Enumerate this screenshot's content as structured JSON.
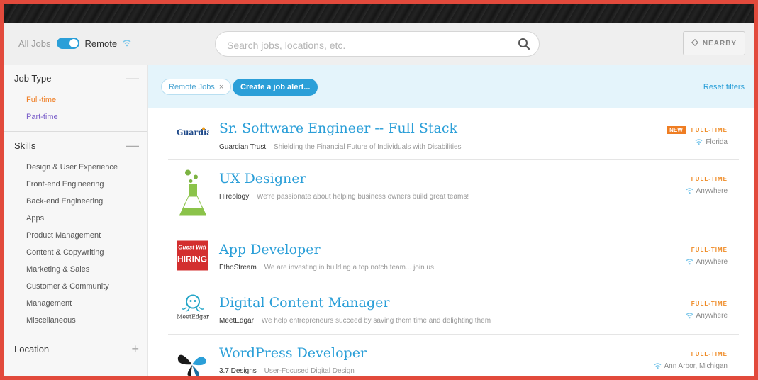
{
  "colors": {
    "accent": "#2b9fd8",
    "frame": "#e24a3c",
    "orange": "#ef7d22"
  },
  "topbar": {
    "all_jobs_label": "All Jobs",
    "remote_label": "Remote",
    "search_placeholder": "Search jobs, locations, etc.",
    "nearby_label": "NEARBY"
  },
  "sidebar": {
    "job_type": {
      "title": "Job Type",
      "items": [
        "Full-time",
        "Part-time"
      ]
    },
    "skills": {
      "title": "Skills",
      "items": [
        "Design & User Experience",
        "Front-end Engineering",
        "Back-end Engineering",
        "Apps",
        "Product Management",
        "Content & Copywriting",
        "Marketing & Sales",
        "Customer & Community",
        "Management",
        "Miscellaneous"
      ]
    },
    "location": {
      "title": "Location"
    }
  },
  "filters": {
    "chip_label": "Remote Jobs",
    "chip_close": "×",
    "alert_label": "Create a job alert...",
    "reset_label": "Reset filters"
  },
  "jobs": [
    {
      "title": "Sr. Software Engineer -- Full Stack",
      "company": "Guardian Trust",
      "tagline": "Shielding the Financial Future of Individuals with Disabilities",
      "badge": "NEW",
      "type": "FULL-TIME",
      "location": "Florida",
      "logo": "guardian-logo",
      "logo_text": "Guardian"
    },
    {
      "title": "UX Designer",
      "company": "Hireology",
      "tagline": "We're passionate about helping business owners build great teams!",
      "badge": "",
      "type": "FULL-TIME",
      "location": "Anywhere",
      "logo": "hireology-flask-logo"
    },
    {
      "title": "App Developer",
      "company": "EthoStream",
      "tagline": "We are investing in building a top notch team... join us.",
      "badge": "",
      "type": "FULL-TIME",
      "location": "Anywhere",
      "logo": "ethostream-hiring-logo",
      "logo_text": "Guest Wifi HIRING"
    },
    {
      "title": "Digital Content Manager",
      "company": "MeetEdgar",
      "tagline": "We help entrepreneurs succeed by saving them time and delighting them",
      "badge": "",
      "type": "FULL-TIME",
      "location": "Anywhere",
      "logo": "meetedgar-octopus-logo",
      "logo_text": "MeetEdgar"
    },
    {
      "title": "WordPress Developer",
      "company": "3.7 Designs",
      "tagline": "User-Focused Digital Design",
      "badge": "",
      "type": "FULL-TIME",
      "location": "Ann Arbor, Michigan",
      "logo": "butterfly-logo"
    }
  ]
}
